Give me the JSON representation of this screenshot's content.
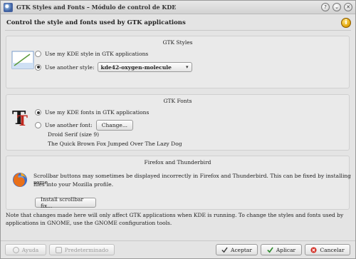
{
  "window": {
    "title": "GTK Styles and Fonts – Módulo de control de KDE",
    "help_btn": "?",
    "min_btn": "⌄",
    "close_btn": "✕"
  },
  "header": {
    "title": "Control the style and fonts used by GTK applications",
    "help_icon": "i"
  },
  "gtk_styles": {
    "title": "GTK Styles",
    "opt_kde": "Use my KDE style in GTK applications",
    "opt_other": "Use another style:",
    "style_value": "kde42-oxygen-molecule"
  },
  "gtk_fonts": {
    "title": "GTK Fonts",
    "opt_kde": "Use my KDE fonts in GTK applications",
    "opt_other": "Use another font:",
    "change_btn": "Change...",
    "font_name": "Droid Serif (size 9)",
    "sample": "The Quick Brown Fox Jumped Over The Lazy Dog"
  },
  "firefox": {
    "title": "Firefox and Thunderbird",
    "message_line1": "Scrollbar buttons may sometimes be displayed incorrectly in Firefox and Thunderbird.  This can be fixed by installing some",
    "message_line2": "files into your Mozilla profile.",
    "install_btn": "Install scrollbar fix..."
  },
  "note": {
    "line1": "Note that changes made here will only affect GTK applications when KDE is running.  To change the styles and fonts used by",
    "line2": "applications in GNOME, use the GNOME configuration tools."
  },
  "footer": {
    "help": "Ayuda",
    "defaults": "Predeterminado",
    "accept": "Aceptar",
    "apply": "Aplicar",
    "cancel": "Cancelar"
  },
  "icons": {
    "app": "gtk-app-icon",
    "style_preview": "style-preview-icon",
    "font": "font-icon",
    "firefox": "firefox-icon"
  }
}
